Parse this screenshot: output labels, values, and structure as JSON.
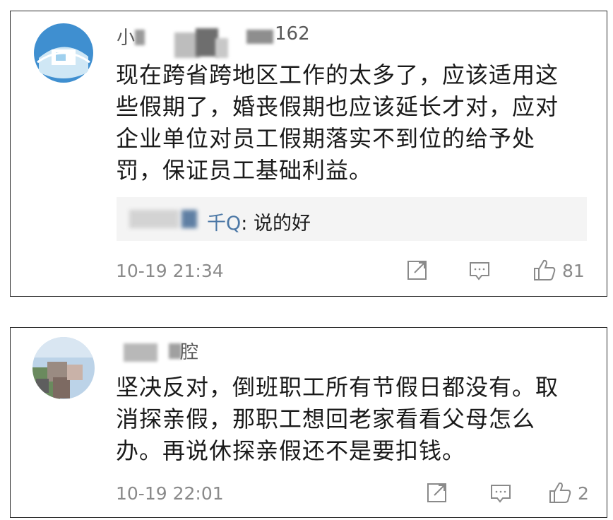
{
  "comments": [
    {
      "username_prefix": "小",
      "username_suffix": "162",
      "text": "现在跨省跨地区工作的太多了，应该适用这\n些假期了，婚丧假期也应该延长才对，应对\n企业单位对员工假期落实不到位的给予处\n罚，保证员工基础利益。",
      "reply": {
        "name_fragment": "千Q",
        "text": ": 说的好"
      },
      "timestamp": "10-19 21:34",
      "likes": "81",
      "icons": [
        "share-icon",
        "comment-icon",
        "like-icon"
      ]
    },
    {
      "username_suffix": "腔",
      "text": "坚决反对，倒班职工所有节假日都没有。取\n消探亲假，那职工想回老家看看父母怎么\n办。再说休探亲假还不是要扣钱。",
      "timestamp": "10-19 22:01",
      "likes": "2",
      "icons": [
        "share-icon",
        "comment-icon",
        "like-icon"
      ]
    }
  ],
  "colors": {
    "card_border": "#2b2b2b",
    "meta_gray": "#8a8a8a",
    "reply_bg": "#f4f4f4",
    "avatar_blue": "#4a90c8"
  }
}
